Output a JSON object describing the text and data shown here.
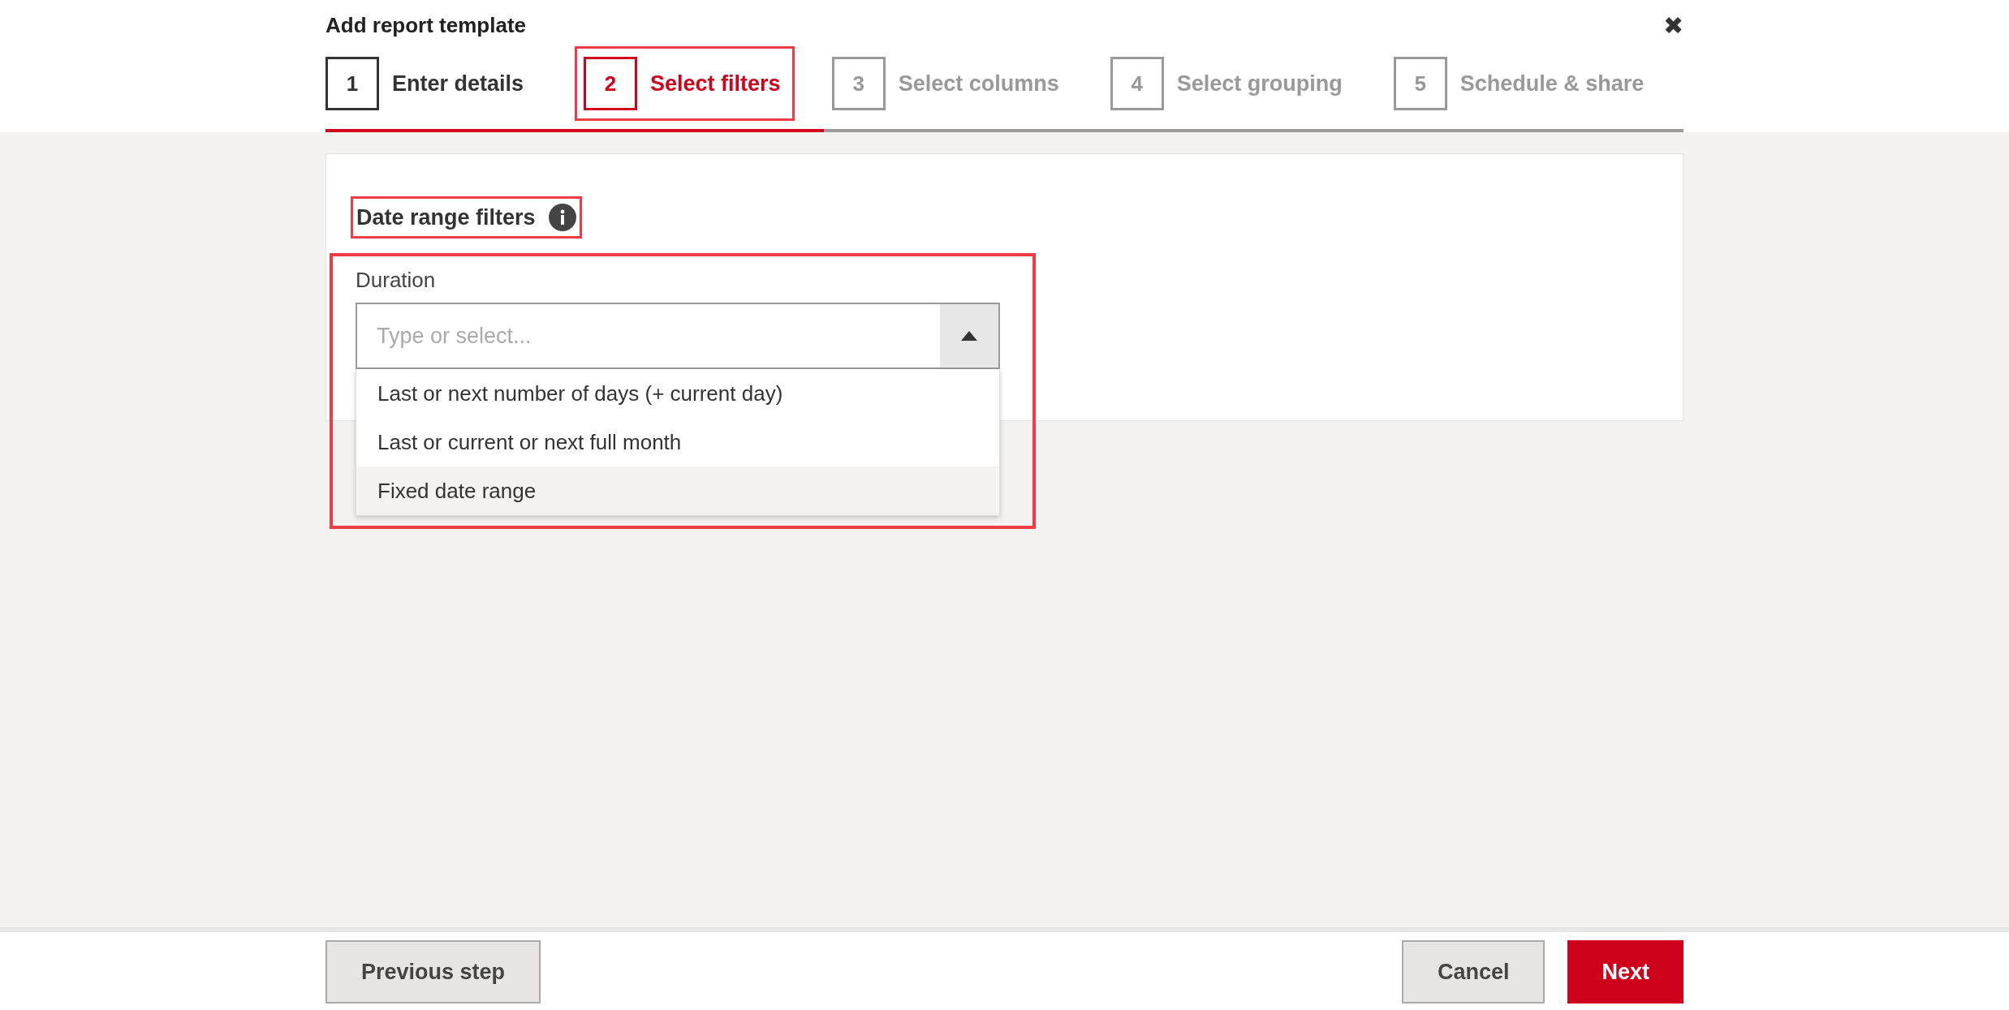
{
  "dialog": {
    "title": "Add report template",
    "close_label": "✖"
  },
  "steps": [
    {
      "number": "1",
      "label": "Enter details",
      "completed": true,
      "selected": false,
      "highlighted": false
    },
    {
      "number": "2",
      "label": "Select filters",
      "completed": false,
      "selected": true,
      "highlighted": true
    },
    {
      "number": "3",
      "label": "Select columns",
      "completed": false,
      "selected": false,
      "highlighted": false
    },
    {
      "number": "4",
      "label": "Select grouping",
      "completed": false,
      "selected": false,
      "highlighted": false
    },
    {
      "number": "5",
      "label": "Schedule & share",
      "completed": false,
      "selected": false,
      "highlighted": false
    }
  ],
  "progress": {
    "level": 0.367
  },
  "section": {
    "heading": "Date range filters",
    "heading_highlighted": true,
    "field": {
      "label": "Duration",
      "placeholder": "Type or select...",
      "expanded": true,
      "highlighted": true,
      "options": [
        {
          "label": "Last or next number of days (+ current day)",
          "selected": false
        },
        {
          "label": "Last or current or next full month",
          "selected": false
        },
        {
          "label": "Fixed date range",
          "selected": true
        }
      ]
    }
  },
  "footer": {
    "previous": "Previous step",
    "cancel": "Cancel",
    "next": "Next"
  }
}
